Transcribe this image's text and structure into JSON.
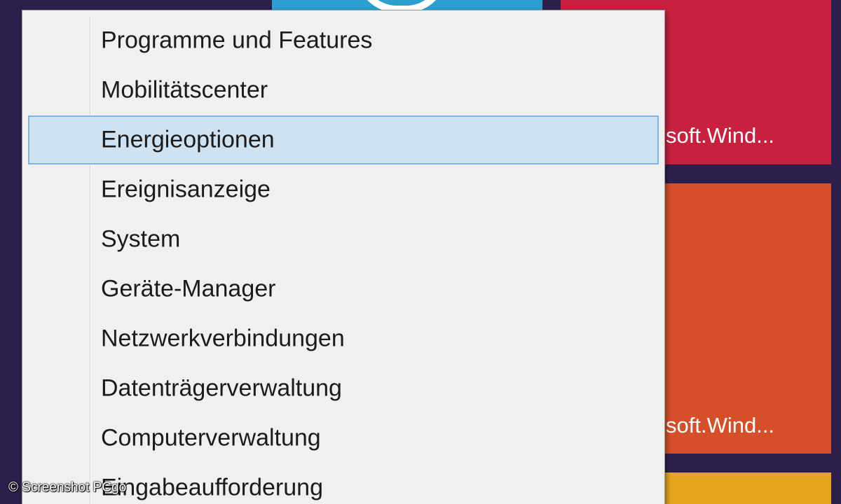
{
  "tiles": [
    {
      "color": "#2a9fd0",
      "label": ""
    },
    {
      "color": "#c8213f",
      "label": "soft.Wind..."
    },
    {
      "color": "#d5502a",
      "label": "soft.Wind..."
    },
    {
      "color": "#e5a41e",
      "label": ""
    }
  ],
  "context_menu": {
    "highlighted_index": 2,
    "items": [
      {
        "label": "Programme und Features"
      },
      {
        "label": "Mobilitätscenter"
      },
      {
        "label": "Energieoptionen"
      },
      {
        "label": "Ereignisanzeige"
      },
      {
        "label": "System"
      },
      {
        "label": "Geräte-Manager"
      },
      {
        "label": "Netzwerkverbindungen"
      },
      {
        "label": "Datenträgerverwaltung"
      },
      {
        "label": "Computerverwaltung"
      },
      {
        "label": "Eingabeaufforderung"
      }
    ]
  },
  "credit": "© Screenshot PCgo",
  "colors": {
    "menu_background": "#f0f0f0",
    "highlight_background": "#cfe2f2",
    "highlight_border": "#7fb6e6",
    "desktop_background": "#2d1f4b"
  }
}
